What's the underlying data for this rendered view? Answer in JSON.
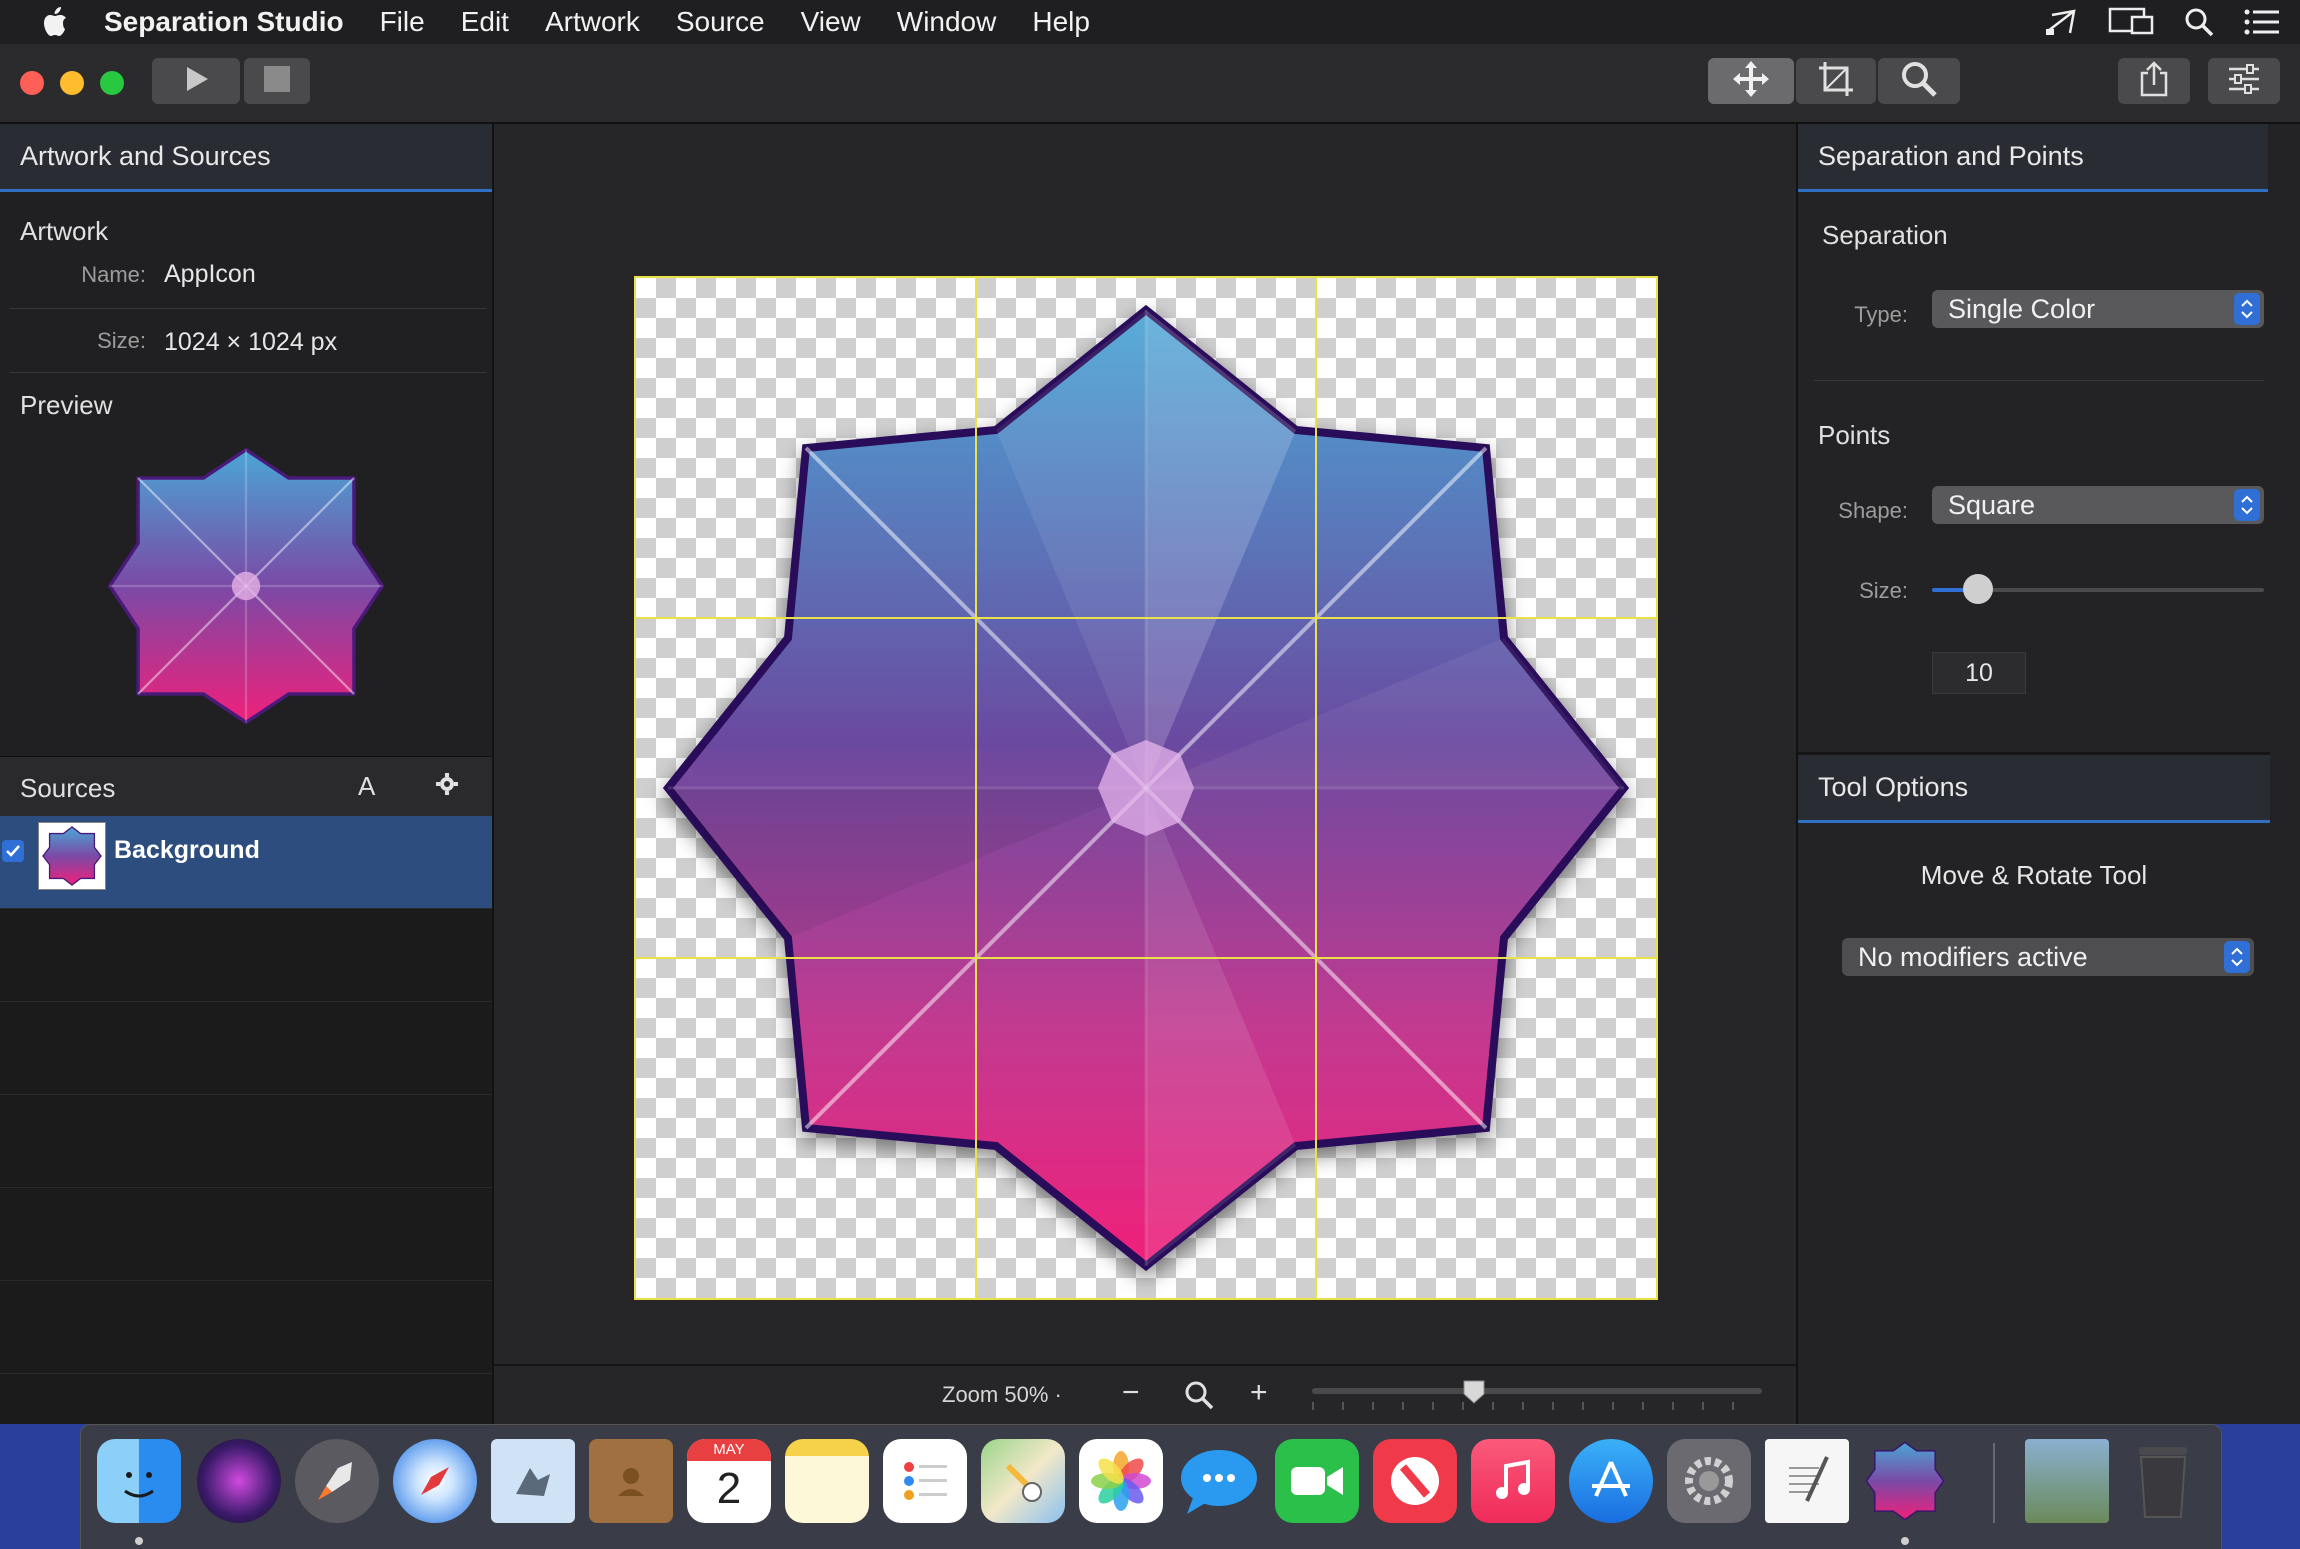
{
  "menubar": {
    "app_name": "Separation Studio",
    "items": [
      "File",
      "Edit",
      "Artwork",
      "Source",
      "View",
      "Window",
      "Help"
    ]
  },
  "icons": {
    "menubar_right": [
      "airplay-icon",
      "display-mirror-icon",
      "spotlight-search-icon",
      "control-center-list-icon"
    ],
    "toolbar": [
      "play-icon",
      "stop-icon",
      "move-tool-icon",
      "crop-tool-icon",
      "zoom-tool-icon",
      "share-icon",
      "inspector-sliders-icon"
    ]
  },
  "left": {
    "header": "Artwork and Sources",
    "artwork_section": "Artwork",
    "name_label": "Name:",
    "name_value": "AppIcon",
    "size_label": "Size:",
    "size_value": "1024 × 1024 px",
    "preview_section": "Preview",
    "sources_header": "Sources",
    "sources_letter": "A",
    "source_item": "Background"
  },
  "right": {
    "header": "Separation and Points",
    "separation_section": "Separation",
    "type_label": "Type:",
    "type_value": "Single Color",
    "points_section": "Points",
    "shape_label": "Shape:",
    "shape_value": "Square",
    "size_label": "Size:",
    "size_value": "10",
    "size_slider_fraction": 0.14,
    "tool_options_header": "Tool Options",
    "tool_name": "Move & Rotate Tool",
    "modifiers_value": "No modifiers active"
  },
  "zoom": {
    "label": "Zoom 50% ·",
    "minus": "−",
    "plus": "+",
    "slider_fraction": 0.36
  },
  "dock": {
    "apps": [
      "Finder",
      "Siri",
      "Launchpad",
      "Safari",
      "Mail",
      "Contacts",
      "Calendar",
      "Notes",
      "Reminders",
      "Maps",
      "Photos",
      "Messages",
      "FaceTime",
      "News",
      "Music",
      "App Store",
      "System Preferences",
      "TextEdit",
      "Separation Studio",
      "Downloads",
      "Trash"
    ],
    "calendar_month": "MAY",
    "calendar_day": "2"
  },
  "colors": {
    "accent": "#2f6fc4",
    "selection": "#2d4d7f",
    "guide": "#e8e14a",
    "gem_top": "#4aa6d6",
    "gem_bottom": "#f0207a"
  }
}
